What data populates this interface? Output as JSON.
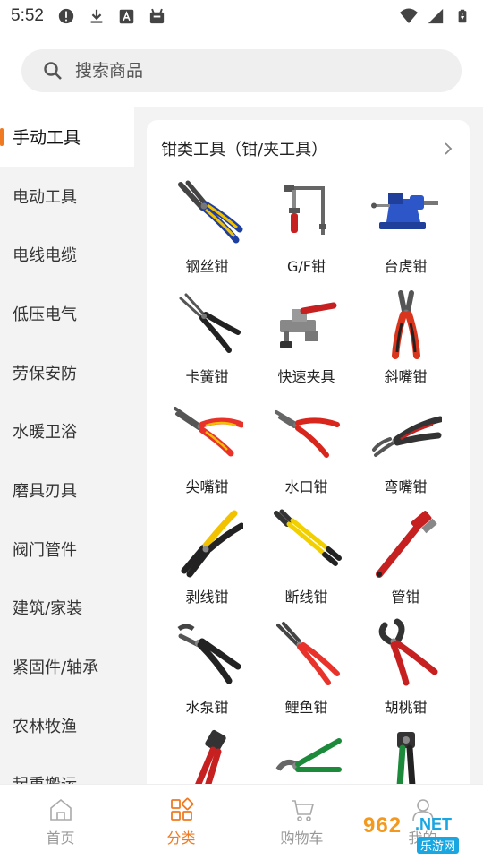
{
  "status_bar": {
    "time": "5:52"
  },
  "search": {
    "placeholder": "搜索商品"
  },
  "sidebar": {
    "items": [
      {
        "label": "手动工具"
      },
      {
        "label": "电动工具"
      },
      {
        "label": "电线电缆"
      },
      {
        "label": "低压电气"
      },
      {
        "label": "劳保安防"
      },
      {
        "label": "水暖卫浴"
      },
      {
        "label": "磨具刃具"
      },
      {
        "label": "阀门管件"
      },
      {
        "label": "建筑/家装"
      },
      {
        "label": "紧固件/轴承"
      },
      {
        "label": "农林牧渔"
      },
      {
        "label": "起重搬运"
      }
    ],
    "active_index": 0
  },
  "category": {
    "title": "钳类工具（钳/夹工具）",
    "products": [
      {
        "label": "钢丝钳",
        "icon": "combination-pliers-icon"
      },
      {
        "label": "G/F钳",
        "icon": "f-clamp-icon"
      },
      {
        "label": "台虎钳",
        "icon": "bench-vise-icon"
      },
      {
        "label": "卡簧钳",
        "icon": "circlip-pliers-icon"
      },
      {
        "label": "快速夹具",
        "icon": "toggle-clamp-icon"
      },
      {
        "label": "斜嘴钳",
        "icon": "diagonal-pliers-icon"
      },
      {
        "label": "尖嘴钳",
        "icon": "needle-nose-pliers-icon"
      },
      {
        "label": "水口钳",
        "icon": "flush-cutter-icon"
      },
      {
        "label": "弯嘴钳",
        "icon": "bent-nose-pliers-icon"
      },
      {
        "label": "剥线钳",
        "icon": "wire-stripper-icon"
      },
      {
        "label": "断线钳",
        "icon": "bolt-cutter-icon"
      },
      {
        "label": "管钳",
        "icon": "pipe-wrench-icon"
      },
      {
        "label": "水泵钳",
        "icon": "water-pump-pliers-icon"
      },
      {
        "label": "鲤鱼钳",
        "icon": "slip-joint-pliers-icon"
      },
      {
        "label": "胡桃钳",
        "icon": "end-cutting-pliers-icon"
      },
      {
        "label": "",
        "icon": "crimping-tool-icon"
      },
      {
        "label": "",
        "icon": "cable-cutter-icon"
      },
      {
        "label": "",
        "icon": "crimper-icon"
      }
    ]
  },
  "bottom_nav": {
    "items": [
      {
        "label": "首页",
        "icon": "home-icon"
      },
      {
        "label": "分类",
        "icon": "category-icon"
      },
      {
        "label": "购物车",
        "icon": "cart-icon"
      },
      {
        "label": "我的",
        "icon": "user-icon"
      }
    ],
    "active_index": 1
  },
  "watermark": {
    "number": "962",
    "domain": ".NET",
    "site": "乐游网"
  },
  "colors": {
    "accent": "#f07a22",
    "nav_inactive": "#999999",
    "sidebar_bg": "#f3f3f3"
  }
}
